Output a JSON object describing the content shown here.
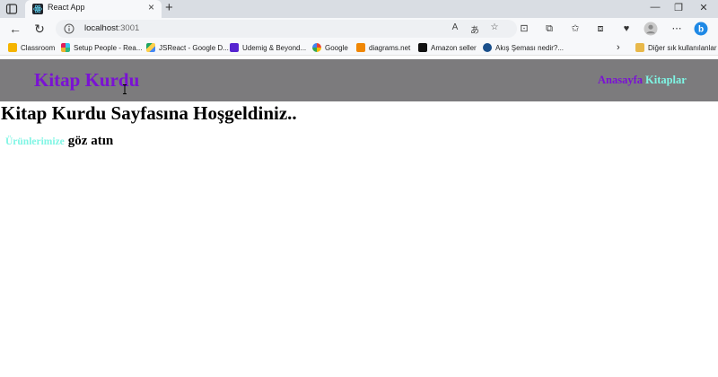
{
  "browser": {
    "tab": {
      "title": "React App",
      "icon": "react-icon"
    },
    "address": {
      "host": "localhost",
      "port": ":3001"
    },
    "bookmarks": [
      {
        "label": "Classroom",
        "icon": "classroom-icon",
        "color": "#f5b400"
      },
      {
        "label": "Setup People - Rea...",
        "icon": "slack-icon",
        "color": "#e01e5a"
      },
      {
        "label": "JSReact - Google D...",
        "icon": "google-drive-icon",
        "color": "#1fa463"
      },
      {
        "label": "Udemig & Beyond...",
        "icon": "udemy-icon",
        "color": "#5624d0"
      },
      {
        "label": "Google",
        "icon": "google-icon",
        "color": "#4285f4"
      },
      {
        "label": "diagrams.net",
        "icon": "diagrams-icon",
        "color": "#f08705"
      },
      {
        "label": "Amazon seller",
        "icon": "amazon-icon",
        "color": "#111111"
      },
      {
        "label": "Akış Şeması nedir?...",
        "icon": "globe-icon",
        "color": "#1a4f8b"
      }
    ],
    "other_bookmarks": {
      "label": "Diğer sık kullanılanlar",
      "icon": "folder-icon"
    }
  },
  "app": {
    "brand": "Kitap Kurdu",
    "nav": [
      {
        "label": "Anasayfa",
        "color": "#7a12d4"
      },
      {
        "label": "Kitaplar",
        "color": "#7ff5e4"
      }
    ],
    "colors": {
      "header_bg": "#7c7b7d",
      "brand": "#7a12d4",
      "accent": "#7ff5e4"
    },
    "heading": "Kitap Kurdu Sayfasına Hoşgeldiniz..",
    "sub": {
      "link": "Ürünlerimize",
      "rest": "göz atın"
    }
  }
}
